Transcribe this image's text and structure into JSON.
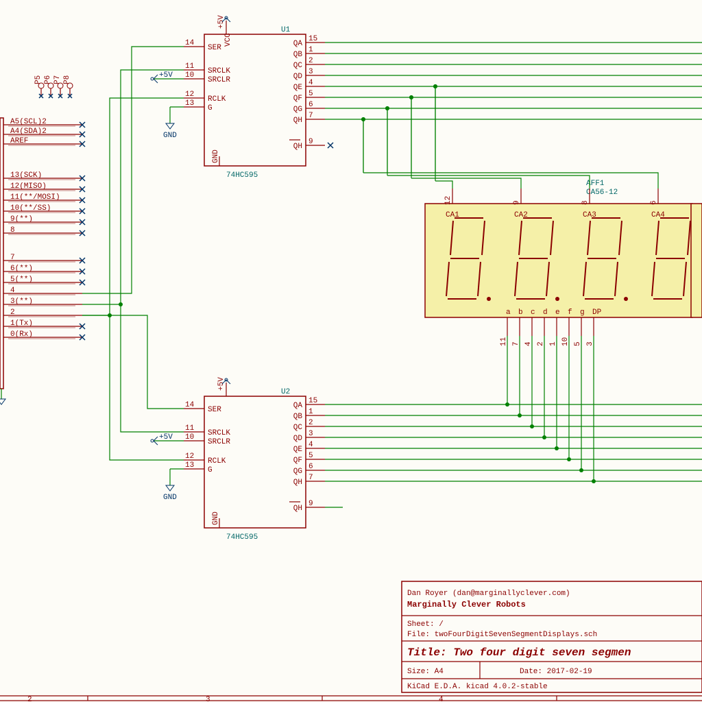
{
  "colors": {
    "bg": "#fdfcf7",
    "wire": "#008000",
    "comp": "#8B0000",
    "teal": "#006666",
    "display": "#F5F0A8"
  },
  "u1": {
    "ref": "U1",
    "value": "74HC595",
    "left": [
      {
        "num": "14",
        "name": "SER"
      },
      {
        "num": "11",
        "name": "SRCLK"
      },
      {
        "num": "10",
        "name": "SRCLR"
      },
      {
        "num": "12",
        "name": "RCLK"
      },
      {
        "num": "13",
        "name": "G"
      }
    ],
    "right": [
      {
        "num": "15",
        "name": "QA"
      },
      {
        "num": "1",
        "name": "QB"
      },
      {
        "num": "2",
        "name": "QC"
      },
      {
        "num": "3",
        "name": "QD"
      },
      {
        "num": "4",
        "name": "QE"
      },
      {
        "num": "5",
        "name": "QF"
      },
      {
        "num": "6",
        "name": "QG"
      },
      {
        "num": "7",
        "name": "QH"
      },
      {
        "num": "9",
        "name": "QH"
      }
    ],
    "pwr": "+5V",
    "gnd": "GND",
    "topLabel": "+5V",
    "gndLabel": "GND"
  },
  "u2": {
    "ref": "U2",
    "value": "74HC595",
    "left": [
      {
        "num": "14",
        "name": "SER"
      },
      {
        "num": "11",
        "name": "SRCLK"
      },
      {
        "num": "10",
        "name": "SRCLR"
      },
      {
        "num": "12",
        "name": "RCLK"
      },
      {
        "num": "13",
        "name": "G"
      }
    ],
    "right": [
      {
        "num": "15",
        "name": "QA"
      },
      {
        "num": "1",
        "name": "QB"
      },
      {
        "num": "2",
        "name": "QC"
      },
      {
        "num": "3",
        "name": "QD"
      },
      {
        "num": "4",
        "name": "QE"
      },
      {
        "num": "5",
        "name": "QF"
      },
      {
        "num": "6",
        "name": "QG"
      },
      {
        "num": "7",
        "name": "QH"
      },
      {
        "num": "9",
        "name": "QH"
      }
    ]
  },
  "display": {
    "ref": "AFF1",
    "value": "CA56-12",
    "topPins": [
      {
        "num": "12",
        "name": "CA1"
      },
      {
        "num": "9",
        "name": "CA2"
      },
      {
        "num": "8",
        "name": "CA3"
      },
      {
        "num": "6",
        "name": "CA4"
      }
    ],
    "botPins": [
      {
        "num": "11",
        "name": "a"
      },
      {
        "num": "7",
        "name": "b"
      },
      {
        "num": "4",
        "name": "c"
      },
      {
        "num": "2",
        "name": "d"
      },
      {
        "num": "1",
        "name": "e"
      },
      {
        "num": "10",
        "name": "f"
      },
      {
        "num": "5",
        "name": "g"
      },
      {
        "num": "3",
        "name": "DP"
      }
    ]
  },
  "mcu_header": {
    "top": [
      "A5(SCL)2",
      "A4(SDA)2",
      "AREF"
    ],
    "mid": [
      "13(SCK)",
      "12(MISO)",
      "11(**/MOSI)",
      "10(**/SS)",
      "9(**)",
      "8"
    ],
    "bot": [
      "7",
      "6(**)",
      "5(**)",
      "4",
      "3(**)",
      "2",
      "1(Tx)",
      "0(Rx)"
    ]
  },
  "conn": {
    "pins": [
      "P5",
      "P6",
      "P7",
      "P8"
    ]
  },
  "titleblock": {
    "author": "Dan Royer (dan@marginallyclever.com)",
    "company": "Marginally Clever Robots",
    "sheet": "Sheet: /",
    "file": "File: twoFourDigitSevenSegmentDisplays.sch",
    "title": "Title: Two four digit seven segmen",
    "size": "Size: A4",
    "date": "Date: 2017-02-19",
    "app": "KiCad E.D.A.  kicad 4.0.2-stable"
  },
  "labels": {
    "p5v": "+5V",
    "gnd": "GND",
    "vcc": "VCC",
    "p5vside": "+5V"
  },
  "ruler": [
    "2",
    "3",
    "4"
  ]
}
